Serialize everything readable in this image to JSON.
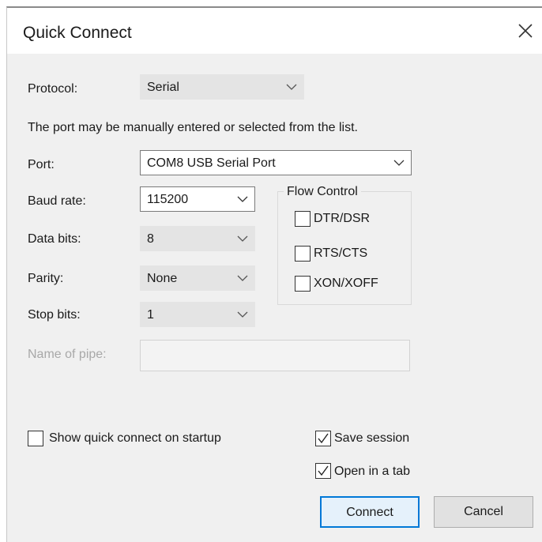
{
  "window": {
    "title": "Quick Connect",
    "close_icon": "close-icon"
  },
  "protocol": {
    "label": "Protocol:",
    "value": "Serial"
  },
  "hint": "The port may be manually entered or selected from the list.",
  "port": {
    "label": "Port:",
    "value": "COM8 USB Serial Port"
  },
  "baud_rate": {
    "label": "Baud rate:",
    "value": "115200"
  },
  "data_bits": {
    "label": "Data bits:",
    "value": "8"
  },
  "parity": {
    "label": "Parity:",
    "value": "None"
  },
  "stop_bits": {
    "label": "Stop bits:",
    "value": "1"
  },
  "pipe": {
    "label": "Name of pipe:",
    "value": ""
  },
  "flow_control": {
    "title": "Flow Control",
    "options": [
      {
        "label": "DTR/DSR",
        "checked": false
      },
      {
        "label": "RTS/CTS",
        "checked": false
      },
      {
        "label": "XON/XOFF",
        "checked": false
      }
    ]
  },
  "options": {
    "show_on_startup": {
      "label": "Show quick connect on startup",
      "checked": false
    },
    "save_session": {
      "label": "Save session",
      "checked": true
    },
    "open_in_tab": {
      "label": "Open in a tab",
      "checked": true
    }
  },
  "buttons": {
    "connect": "Connect",
    "cancel": "Cancel"
  },
  "colors": {
    "default_button_border": "#0078d7",
    "default_button_bg": "#e5f1fb",
    "dialog_bg": "#f0f0f0"
  }
}
